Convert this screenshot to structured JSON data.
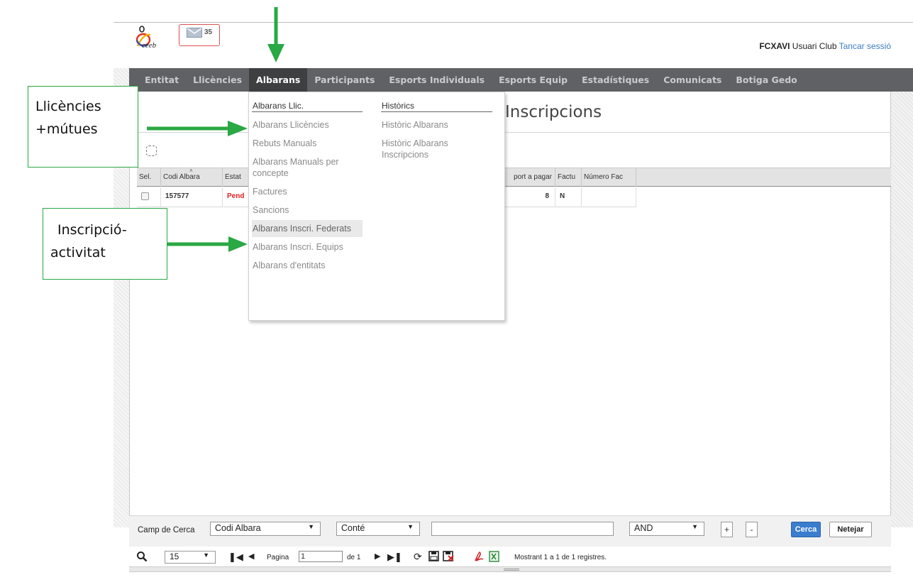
{
  "header": {
    "mail_count": "35",
    "user_code": "FCXAVI",
    "user_role": "Usuari Club",
    "logout_label": "Tancar sessió"
  },
  "logo": {
    "text": "ceeb"
  },
  "nav": {
    "items": [
      "Entitat",
      "Llicències",
      "Albarans",
      "Participants",
      "Esports Individuals",
      "Esports Equip",
      "Estadístiques",
      "Comunicats",
      "Botiga Gedo"
    ],
    "active": "Albarans"
  },
  "page": {
    "title": "Inscripcions"
  },
  "dropdown": {
    "col1_header": "Albarans Llic.",
    "col1_items": [
      "Albarans Llicències",
      "Rebuts Manuals",
      "Albarans Manuals per concepte",
      "Factures",
      "Sancions",
      "Albarans Inscri. Federats",
      "Albarans Inscri. Equips",
      "Albarans d'entitats"
    ],
    "col2_header": "Històrics",
    "col2_items": [
      "Històric Albarans",
      "Històric Albarans Inscripcions"
    ]
  },
  "grid": {
    "headers": [
      "Sel.",
      "Codi Albara",
      "Estat",
      "port a pagar",
      "Factu",
      "Número Fac"
    ],
    "rows": [
      {
        "codi": "157577",
        "estat": "Pend",
        "import": "8",
        "factura": "N",
        "numero": ""
      }
    ]
  },
  "search": {
    "field_label": "Camp de Cerca",
    "field_value": "Codi Albara",
    "op_value": "Conté",
    "text_value": "",
    "logic_value": "AND",
    "plus_label": "+",
    "minus_label": "-",
    "search_label": "Cerca",
    "clear_label": "Netejar"
  },
  "pager": {
    "page_size": "15",
    "page_label": "Pagina",
    "page_value": "1",
    "of_label": "de 1",
    "records_text": "Mostrant 1 a 1 de 1 registres."
  },
  "annotations": {
    "box1_line1": "Llicències",
    "box1_line2": "+mútues",
    "box2_line1": "Inscripció-",
    "box2_line2": "activitat"
  },
  "colors": {
    "nav_bg": "#5f6164",
    "nav_active": "#3e3f41",
    "annotation_green": "#2aa843",
    "search_button": "#3a7dce",
    "status_red": "#e02020"
  }
}
